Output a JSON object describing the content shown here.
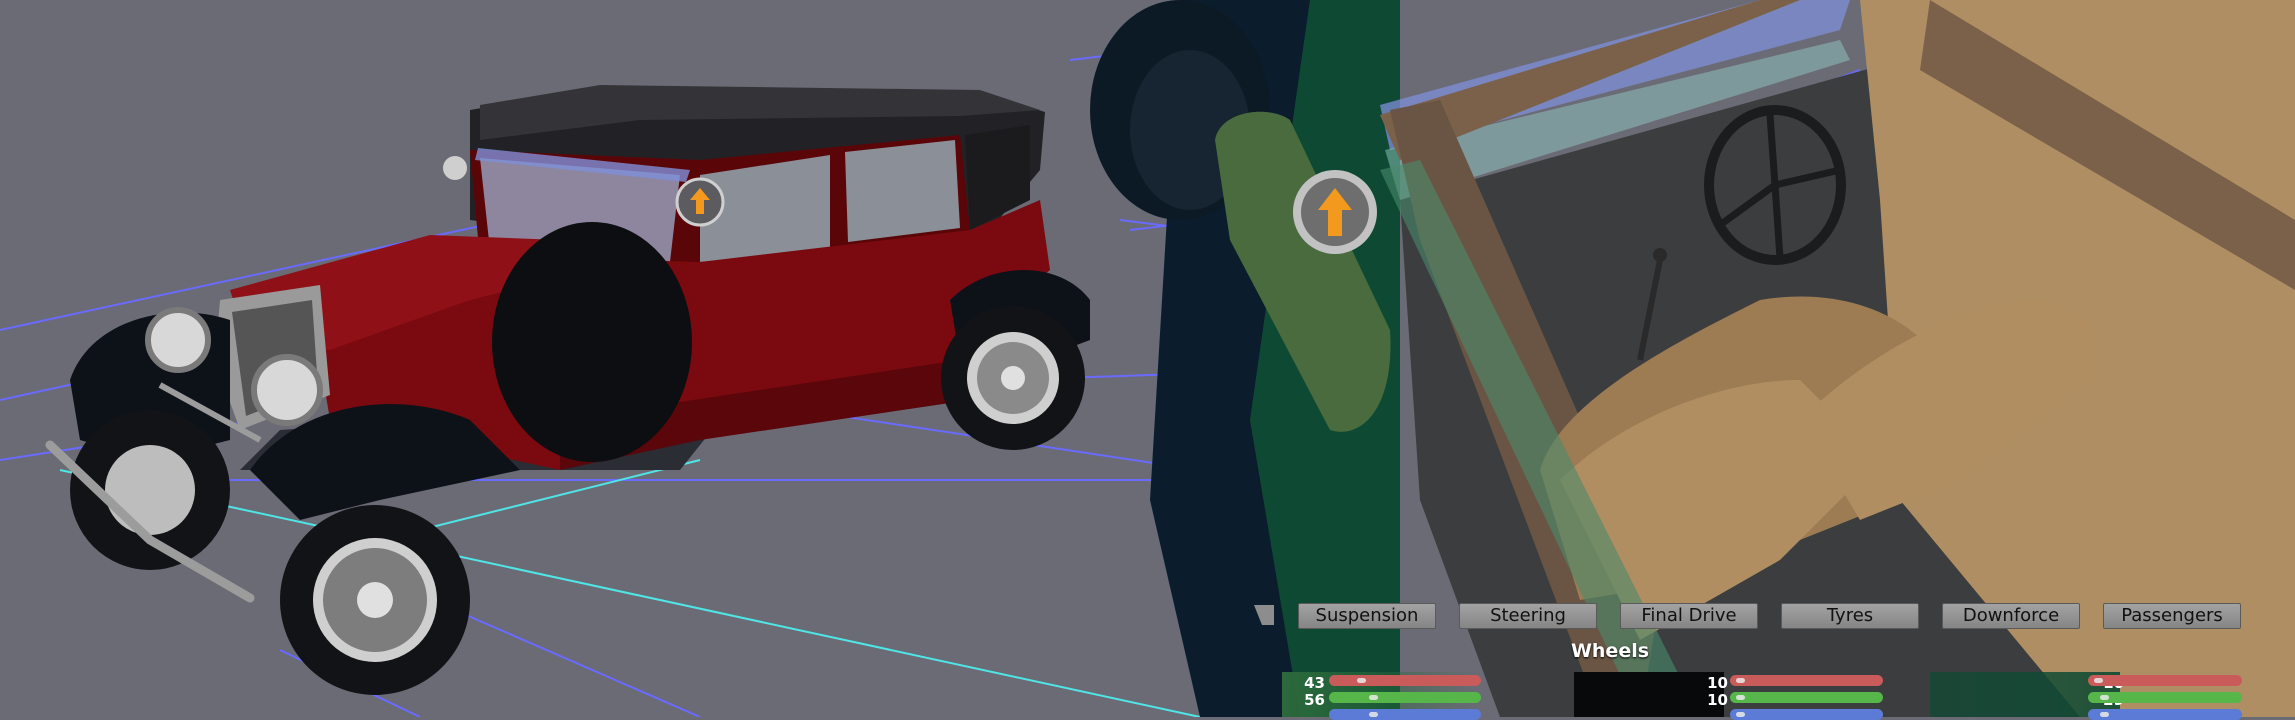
{
  "tabs": [
    {
      "label": "Suspension"
    },
    {
      "label": "Steering"
    },
    {
      "label": "Final Drive"
    },
    {
      "label": "Tyres"
    },
    {
      "label": "Downforce"
    },
    {
      "label": "Passengers"
    }
  ],
  "section_title": "Wheels",
  "wheel_panels": [
    {
      "values": [
        "43",
        "56"
      ]
    },
    {
      "values": [
        "10",
        "10"
      ]
    },
    {
      "values": [
        "10",
        "29"
      ]
    }
  ],
  "colors": {
    "background": "#6b6b76",
    "grid_blue": "#6a6aff",
    "grid_cyan": "#4fe6e6",
    "body_red": "#7a0a10",
    "body_green": "#0e4a33",
    "bar_red": "#c95b5b",
    "bar_green": "#57b64a",
    "bar_blue": "#5b7bd6",
    "accent_orange": "#f39a1e"
  },
  "icons": [
    "up-arrow-badge-icon"
  ]
}
